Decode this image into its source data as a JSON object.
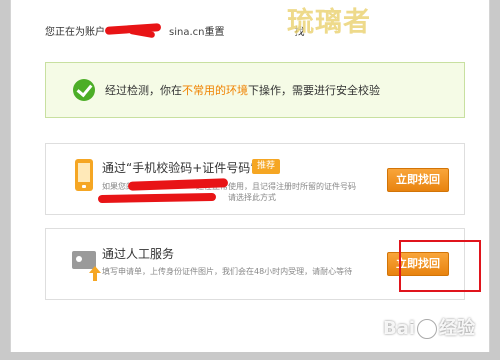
{
  "header": {
    "account_prefix": "您正在为账户",
    "account_domain": "sina.cn",
    "account_suffix": "重置",
    "after_text": "找"
  },
  "watermark": {
    "top_text": "琉璃者",
    "baidu_text_a": "Bai",
    "baidu_text_b": "经验"
  },
  "notice": {
    "text_before": "经过检测，你在",
    "text_highlight": "不常用的环境",
    "text_after": "下操作，需要进行安全校验"
  },
  "options": [
    {
      "title": "通过“手机校验码+证件号码”",
      "badge": "推荐",
      "desc_line1_prefix": "如果您的",
      "desc_line1_suffix": "还在正常使用，且记得注册时所留的证件号码",
      "desc_line2_suffix": "请选择此方式",
      "button": "立即找回"
    },
    {
      "title": "通过人工服务",
      "desc": "填写申请单，上传身份证件图片，我们会在48小时内受理，请耐心等待",
      "button": "立即找回"
    }
  ],
  "colors": {
    "accent": "#f5a623",
    "highlight": "#f08200",
    "success": "#4cae27",
    "annotation": "#e0141c"
  }
}
